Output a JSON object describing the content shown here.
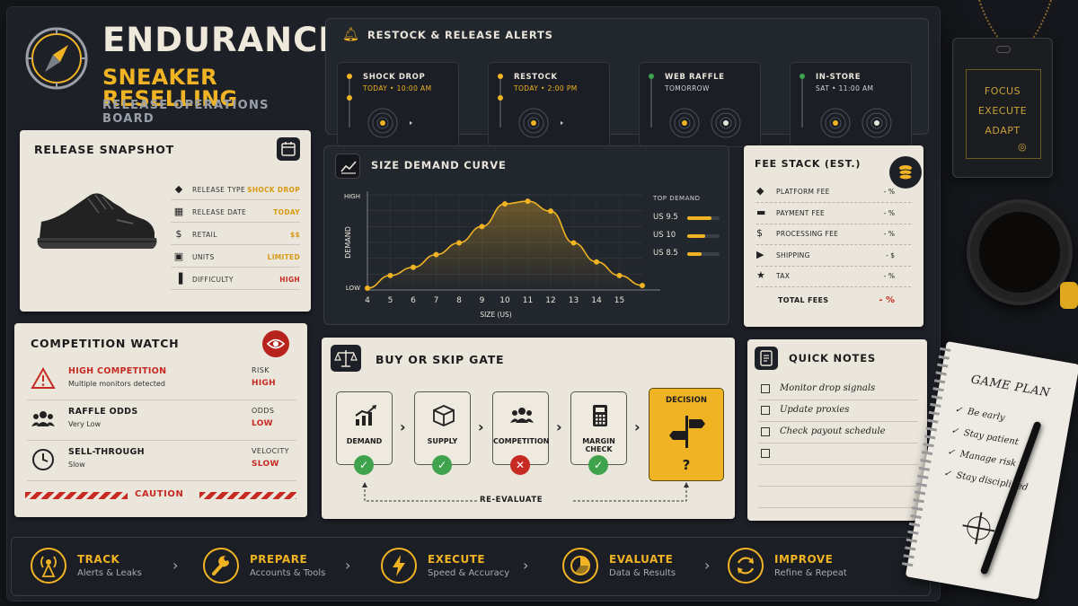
{
  "logo": {
    "title": "ENDURANCE",
    "subtitle": "SNEAKER RESELLING",
    "tagline": "RELEASE OPERATIONS BOARD"
  },
  "alerts": {
    "title": "RESTOCK & RELEASE ALERTS",
    "items": [
      {
        "title": "SHOCK DROP",
        "sub": "TODAY • 10:00 AM",
        "status_color": "#f0b323"
      },
      {
        "title": "RESTOCK",
        "sub": "TODAY • 2:00 PM",
        "status_color": "#f0b323"
      },
      {
        "title": "WEB RAFFLE",
        "sub": "TOMORROW",
        "status_color": "#3fa34d"
      },
      {
        "title": "IN-STORE",
        "sub": "SAT • 11:00 AM",
        "status_color": "#3fa34d"
      }
    ]
  },
  "snapshot": {
    "title": "RELEASE SNAPSHOT",
    "rows": [
      {
        "icon": "tag-icon",
        "label": "RELEASE TYPE",
        "value": "SHOCK DROP",
        "color": "#d89a12"
      },
      {
        "icon": "calendar-icon",
        "label": "RELEASE DATE",
        "value": "TODAY",
        "color": "#d89a12"
      },
      {
        "icon": "dollar-icon",
        "label": "RETAIL",
        "value": "$$",
        "color": "#d89a12"
      },
      {
        "icon": "box-icon",
        "label": "UNITS",
        "value": "LIMITED",
        "color": "#d89a12"
      },
      {
        "icon": "bars-icon",
        "label": "DIFFICULTY",
        "value": "HIGH",
        "color": "#c62a22"
      }
    ]
  },
  "curve": {
    "title": "SIZE DEMAND CURVE",
    "top_demand_label": "TOP DEMAND",
    "top_demand": [
      {
        "size": "US 9.5",
        "level": 0.75
      },
      {
        "size": "US 10",
        "level": 0.55
      },
      {
        "size": "US 8.5",
        "level": 0.45
      }
    ]
  },
  "chart_data": {
    "type": "line",
    "xlabel": "SIZE (US)",
    "ylabel": "DEMAND",
    "y_tick_labels": [
      "HIGH",
      "LOW"
    ],
    "x_ticks": [
      4,
      5,
      6,
      7,
      8,
      9,
      10,
      11,
      12,
      13,
      14,
      15
    ],
    "x": [
      4,
      5,
      6,
      7,
      8,
      9,
      10,
      11,
      12,
      13,
      14,
      15,
      16
    ],
    "values": [
      0.02,
      0.16,
      0.25,
      0.39,
      0.52,
      0.7,
      0.95,
      0.98,
      0.87,
      0.52,
      0.31,
      0.16,
      0.05
    ],
    "ylim": [
      0,
      1.05
    ],
    "xlim": [
      4,
      16
    ],
    "grid": true,
    "line_color": "#f0b323"
  },
  "fees": {
    "title": "FEE STACK (EST.)",
    "rows": [
      {
        "icon": "tag-icon",
        "label": "PLATFORM FEE",
        "value": "- %"
      },
      {
        "icon": "card-icon",
        "label": "PAYMENT FEE",
        "value": "- %"
      },
      {
        "icon": "dollar-icon",
        "label": "PROCESSING FEE",
        "value": "- %"
      },
      {
        "icon": "truck-icon",
        "label": "SHIPPING",
        "value": "- $"
      },
      {
        "icon": "star-icon",
        "label": "TAX",
        "value": "- %"
      }
    ],
    "total_label": "TOTAL FEES",
    "total_value": "- %"
  },
  "competition": {
    "title": "COMPETITION WATCH",
    "rows": [
      {
        "icon": "warning-icon",
        "title": "HIGH COMPETITION",
        "sub": "Multiple monitors detected",
        "key": "RISK",
        "value": "HIGH",
        "title_color": "#c62a22",
        "value_color": "#c62a22"
      },
      {
        "icon": "people-icon",
        "title": "RAFFLE ODDS",
        "sub": "Very Low",
        "key": "ODDS",
        "value": "LOW",
        "title_color": "#1c1c1c",
        "value_color": "#c62a22"
      },
      {
        "icon": "clock-icon",
        "title": "SELL-THROUGH",
        "sub": "Slow",
        "key": "VELOCITY",
        "value": "SLOW",
        "title_color": "#1c1c1c",
        "value_color": "#c62a22"
      }
    ],
    "caution": "CAUTION"
  },
  "gate": {
    "title": "BUY OR SKIP GATE",
    "steps": [
      {
        "label": "DEMAND",
        "icon": "chart-up-icon",
        "status": "pass"
      },
      {
        "label": "SUPPLY",
        "icon": "box-icon",
        "status": "pass"
      },
      {
        "label": "COMPETITION",
        "icon": "people-icon",
        "status": "fail"
      },
      {
        "label": "MARGIN CHECK",
        "icon": "calculator-icon",
        "status": "pass"
      }
    ],
    "decision_label": "DECISION",
    "decision_mark": "?",
    "reevaluate": "RE-EVALUATE"
  },
  "notes": {
    "title": "QUICK NOTES",
    "items": [
      "Monitor drop signals",
      "Update proxies",
      "Check payout schedule",
      ""
    ]
  },
  "workflow": [
    {
      "title": "TRACK",
      "sub": "Alerts & Leaks",
      "icon": "antenna-icon"
    },
    {
      "title": "PREPARE",
      "sub": "Accounts & Tools",
      "icon": "wrench-icon"
    },
    {
      "title": "EXECUTE",
      "sub": "Speed & Accuracy",
      "icon": "lightning-icon"
    },
    {
      "title": "EVALUATE",
      "sub": "Data & Results",
      "icon": "pie-icon"
    },
    {
      "title": "IMPROVE",
      "sub": "Refine & Repeat",
      "icon": "refresh-icon"
    }
  ],
  "tag": {
    "lines": [
      "FOCUS",
      "EXECUTE",
      "ADAPT"
    ]
  },
  "notebook": {
    "title": "GAME PLAN",
    "items": [
      "Be early",
      "Stay patient",
      "Manage risk",
      "Stay disciplined"
    ]
  },
  "colors": {
    "accent": "#f0b323",
    "danger": "#c62a22",
    "success": "#3fa34d",
    "paper": "#ebe6dc",
    "board": "#1d2027"
  }
}
